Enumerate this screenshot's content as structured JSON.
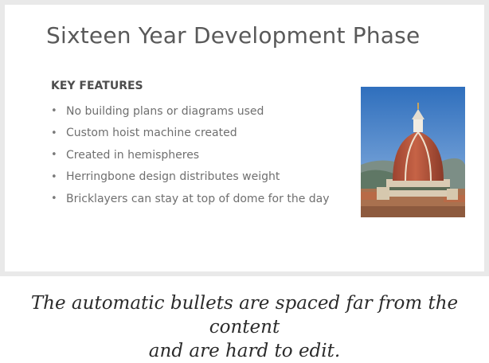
{
  "slide": {
    "title": "Sixteen Year Development Phase",
    "section_heading": "KEY FEATURES",
    "bullet_marker": "•",
    "bullets": [
      "No building plans or diagrams used",
      "Custom hoist machine created",
      "Created in hemispheres",
      "Herringbone design distributes weight",
      "Bricklayers can stay at top of dome for the day"
    ],
    "photo_icon": "dome-photo"
  },
  "caption": {
    "line1": "The automatic bullets are spaced far from the content",
    "line2": "and are hard to edit."
  },
  "colors": {
    "frame": "#e9e9e9",
    "title_text": "#595959",
    "body_text": "#6f6f6f",
    "sky": "#4f86c8",
    "dome_tiles": "#b5543a"
  }
}
